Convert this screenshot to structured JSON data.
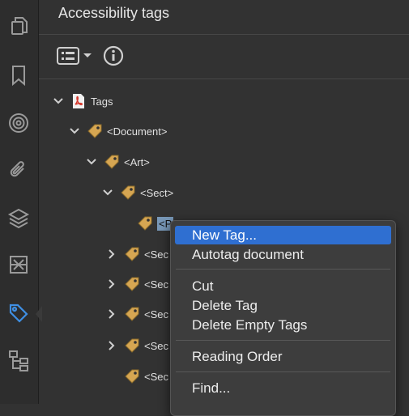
{
  "panel": {
    "title": "Accessibility tags"
  },
  "icons": {
    "sidebar": [
      "pages-icon",
      "bookmark-icon",
      "target-icon",
      "attachment-icon",
      "layers-icon",
      "content-icon",
      "tags-icon",
      "model-tree-icon"
    ],
    "options": "options-menu-icon",
    "info": "info-icon"
  },
  "colors": {
    "background": "#323232",
    "tag": "#d6a652",
    "highlight": "#2f6fd1",
    "selection": "#7898b8",
    "pdf_red": "#d63b30"
  },
  "tree": {
    "root": "Tags",
    "document": "<Document>",
    "art": "<Art>",
    "sect": "<Sect>",
    "selected": "<P",
    "sect2": "<Sec",
    "sect3": "<Sec",
    "sect4": "<Sec",
    "sect5": "<Sec",
    "sect6": "<Sec"
  },
  "context_menu": {
    "new_tag": "New Tag...",
    "autotag": "Autotag document",
    "cut": "Cut",
    "delete_tag": "Delete Tag",
    "delete_empty": "Delete Empty Tags",
    "reading_order": "Reading Order",
    "find": "Find..."
  }
}
